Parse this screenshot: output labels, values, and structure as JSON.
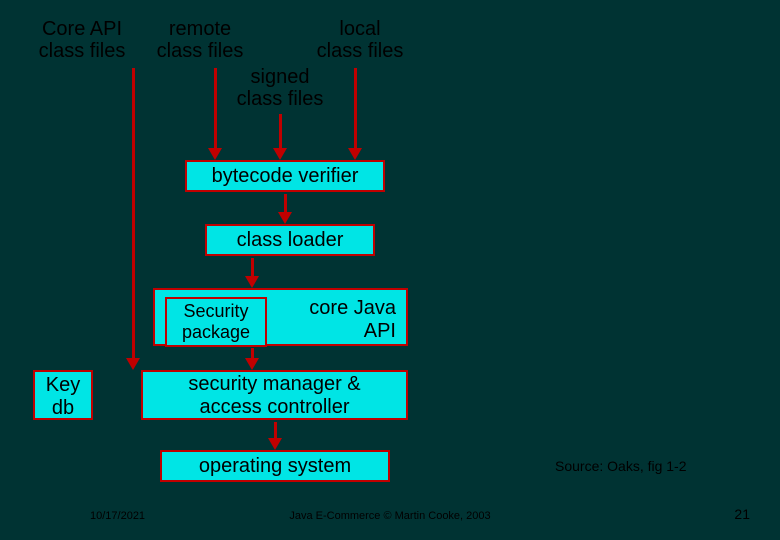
{
  "chart_data": {
    "type": "diagram",
    "nodes": [
      {
        "id": "core_api",
        "text": "Core API class files",
        "kind": "source"
      },
      {
        "id": "remote",
        "text": "remote class files",
        "kind": "source"
      },
      {
        "id": "signed",
        "text": "signed class files",
        "kind": "source"
      },
      {
        "id": "local",
        "text": "local class files",
        "kind": "source"
      },
      {
        "id": "verifier",
        "text": "bytecode verifier",
        "kind": "box"
      },
      {
        "id": "loader",
        "text": "class loader",
        "kind": "box"
      },
      {
        "id": "sec_core",
        "text": "Security package / core Java API",
        "kind": "box"
      },
      {
        "id": "keydb",
        "text": "Key db",
        "kind": "box"
      },
      {
        "id": "sec_mgr",
        "text": "security manager & access controller",
        "kind": "box"
      },
      {
        "id": "os",
        "text": "operating system",
        "kind": "box"
      }
    ],
    "edges": [
      [
        "core_api",
        "sec_mgr"
      ],
      [
        "remote",
        "verifier"
      ],
      [
        "signed",
        "verifier"
      ],
      [
        "local",
        "verifier"
      ],
      [
        "verifier",
        "loader"
      ],
      [
        "loader",
        "sec_core"
      ],
      [
        "sec_core",
        "sec_mgr"
      ],
      [
        "keydb",
        "sec_mgr"
      ],
      [
        "sec_mgr",
        "os"
      ]
    ]
  },
  "labels": {
    "core_api_l1": "Core API",
    "core_api_l2": "class files",
    "remote_l1": "remote",
    "remote_l2": "class files",
    "signed_l1": "signed",
    "signed_l2": "class files",
    "local_l1": "local",
    "local_l2": "class files"
  },
  "boxes": {
    "verifier": "bytecode verifier",
    "loader": "class loader",
    "security_pkg": "Security",
    "security_pkg2": "package",
    "core_java": "core Java",
    "core_api": "API",
    "keydb_l1": "Key",
    "keydb_l2": "db",
    "secmgr_l1": "security manager &",
    "secmgr_l2": "access controller",
    "os": "operating system"
  },
  "footer": {
    "date": "10/17/2021",
    "center": "Java E-Commerce © Martin Cooke, 2003",
    "page": "21"
  },
  "source_note": "Source: Oaks, fig 1-2"
}
